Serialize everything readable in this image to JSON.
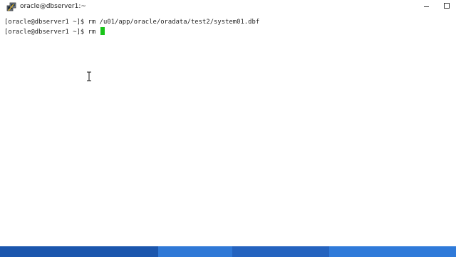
{
  "window": {
    "title": "oracle@dbserver1:~",
    "minimize_icon": "minimize-icon",
    "maximize_icon": "maximize-icon",
    "app_icon": "putty-icon"
  },
  "terminal": {
    "lines": [
      "[oracle@dbserver1 ~]$ rm /u01/app/oracle/oradata/test2/system01.dbf",
      "[oracle@dbserver1 ~]$ rm "
    ],
    "cursor_color": "#19c419"
  },
  "colors": {
    "taskbar": "#1f5fb8",
    "background": "#ffffff",
    "text": "#222222"
  }
}
